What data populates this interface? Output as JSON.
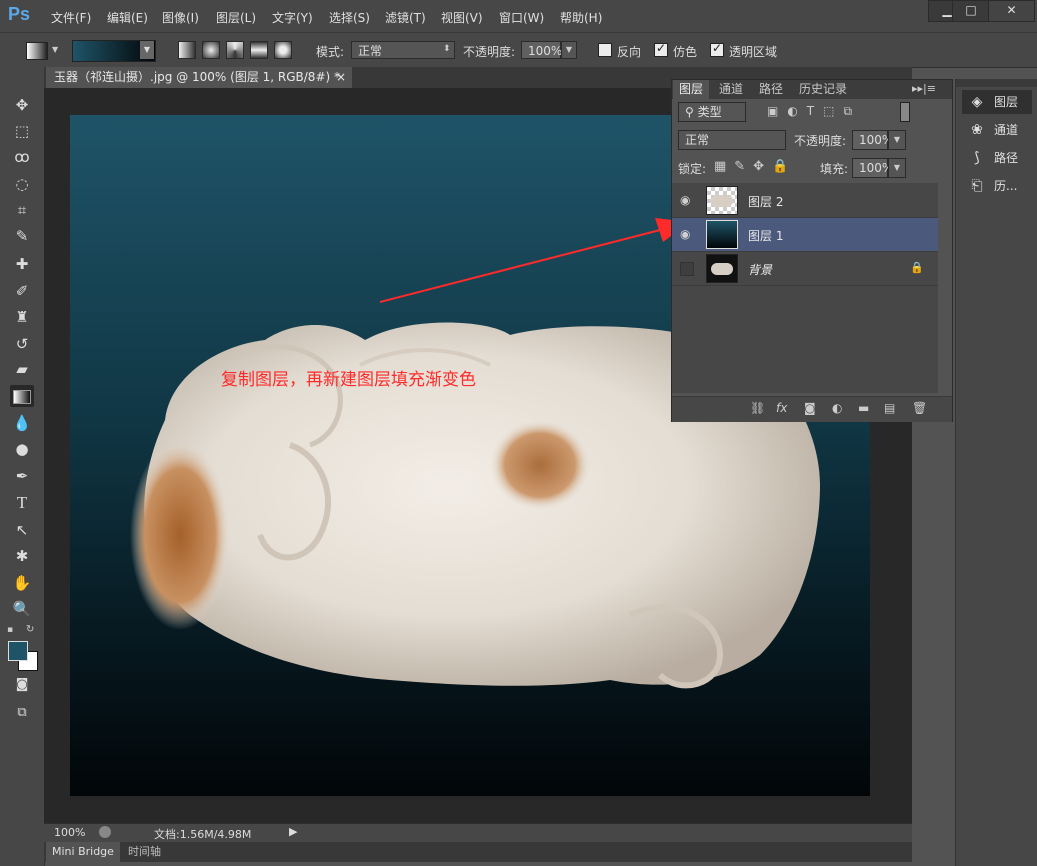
{
  "app": {
    "logo": "Ps"
  },
  "menu": [
    "文件(F)",
    "编辑(E)",
    "图像(I)",
    "图层(L)",
    "文字(Y)",
    "选择(S)",
    "滤镜(T)",
    "视图(V)",
    "窗口(W)",
    "帮助(H)"
  ],
  "window_controls": {
    "minimize": "▁",
    "maximize": "□",
    "close": "✕"
  },
  "options": {
    "mode_label": "模式:",
    "mode_value": "正常",
    "opacity_label": "不透明度:",
    "opacity_value": "100%",
    "reverse_label": "反向",
    "dither_label": "仿色",
    "transparency_label": "透明区域",
    "reverse_checked": false,
    "dither_checked": true,
    "transparency_checked": true
  },
  "document": {
    "tab_title": "玉器（祁连山摄）.jpg @ 100% (图层 1, RGB/8#) *",
    "tab_close": "×",
    "annotation": "复制图层，再新建图层填充渐变色"
  },
  "status": {
    "zoom": "100%",
    "doc_info": "文档:1.56M/4.98M"
  },
  "bottom_tabs": [
    "Mini Bridge",
    "时间轴"
  ],
  "layers_panel": {
    "tabs": [
      "图层",
      "通道",
      "路径",
      "历史记录"
    ],
    "filter_type": "类型",
    "blend_mode": "正常",
    "opacity_label": "不透明度:",
    "opacity_value": "100%",
    "lock_label": "锁定:",
    "fill_label": "填充:",
    "fill_value": "100%",
    "layers": [
      {
        "name": "图层 2",
        "visible": true,
        "selected": false,
        "locked": false
      },
      {
        "name": "图层 1",
        "visible": true,
        "selected": true,
        "locked": false
      },
      {
        "name": "背景",
        "visible": false,
        "selected": false,
        "locked": true
      }
    ]
  },
  "right_dock": [
    "图层",
    "通道",
    "路径",
    "历..."
  ],
  "colors": {
    "foreground": "#1f5468",
    "background": "#ffffff",
    "gradient_start": "#1f5468",
    "gradient_end": "#020608",
    "annotation": "#ff2a2a",
    "selected_layer": "#4b5a7c"
  }
}
